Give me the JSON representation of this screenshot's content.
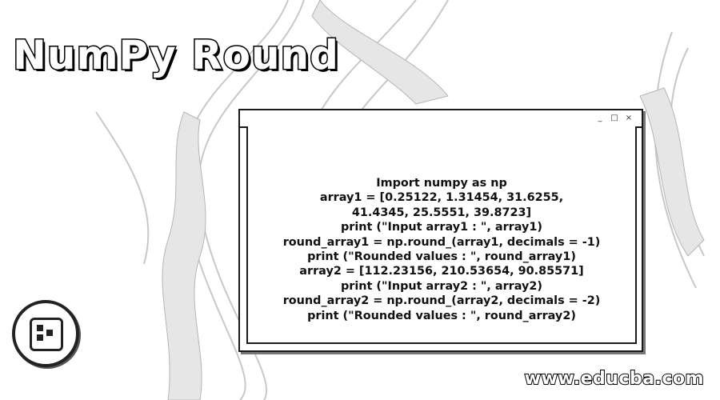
{
  "title": "NumPy Round",
  "window": {
    "controls": [
      "_",
      "□",
      "×"
    ],
    "code_lines": [
      "Import numpy as np",
      "array1 = [0.25122, 1.31454, 31.6255,",
      "41.4345, 25.5551, 39.8723]",
      "print (\"Input array1 : \", array1)",
      "round_array1 = np.round_(array1, decimals = -1)",
      "print (\"Rounded values : \", round_array1)",
      "array2 = [112.23156, 210.53654, 90.85571]",
      "print (\"Input array2 : \", array2)",
      "round_array2 = np.round_(array2, decimals = -2)",
      "print (\"Rounded values : \", round_array2)"
    ]
  },
  "logo": {
    "icon": "educba-logo-icon"
  },
  "watermark": "www.educba.com",
  "colors": {
    "background": "#ffffff",
    "ink": "#111111"
  }
}
